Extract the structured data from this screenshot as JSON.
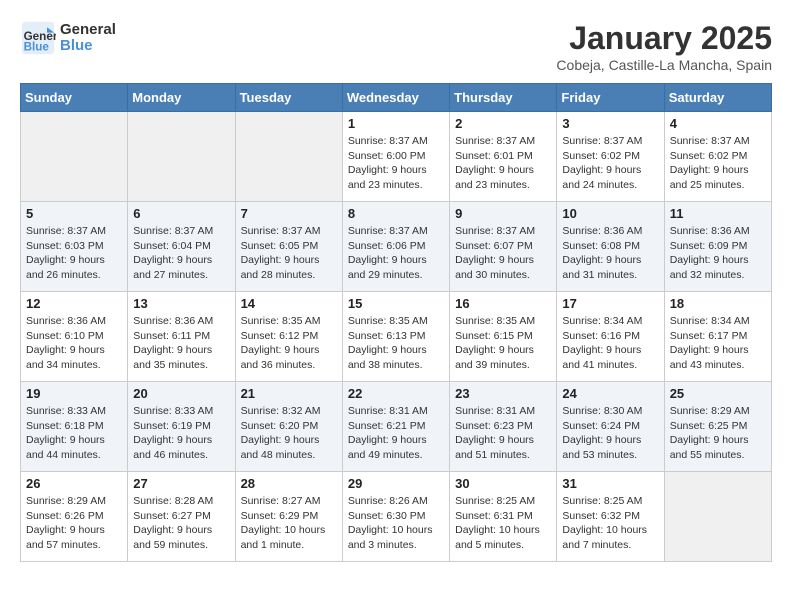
{
  "header": {
    "logo_line1": "General",
    "logo_line2": "Blue",
    "title": "January 2025",
    "subtitle": "Cobeja, Castille-La Mancha, Spain"
  },
  "weekdays": [
    "Sunday",
    "Monday",
    "Tuesday",
    "Wednesday",
    "Thursday",
    "Friday",
    "Saturday"
  ],
  "weeks": [
    [
      {
        "day": "",
        "sunrise": "",
        "sunset": "",
        "daylight": ""
      },
      {
        "day": "",
        "sunrise": "",
        "sunset": "",
        "daylight": ""
      },
      {
        "day": "",
        "sunrise": "",
        "sunset": "",
        "daylight": ""
      },
      {
        "day": "1",
        "sunrise": "Sunrise: 8:37 AM",
        "sunset": "Sunset: 6:00 PM",
        "daylight": "Daylight: 9 hours and 23 minutes."
      },
      {
        "day": "2",
        "sunrise": "Sunrise: 8:37 AM",
        "sunset": "Sunset: 6:01 PM",
        "daylight": "Daylight: 9 hours and 23 minutes."
      },
      {
        "day": "3",
        "sunrise": "Sunrise: 8:37 AM",
        "sunset": "Sunset: 6:02 PM",
        "daylight": "Daylight: 9 hours and 24 minutes."
      },
      {
        "day": "4",
        "sunrise": "Sunrise: 8:37 AM",
        "sunset": "Sunset: 6:02 PM",
        "daylight": "Daylight: 9 hours and 25 minutes."
      }
    ],
    [
      {
        "day": "5",
        "sunrise": "Sunrise: 8:37 AM",
        "sunset": "Sunset: 6:03 PM",
        "daylight": "Daylight: 9 hours and 26 minutes."
      },
      {
        "day": "6",
        "sunrise": "Sunrise: 8:37 AM",
        "sunset": "Sunset: 6:04 PM",
        "daylight": "Daylight: 9 hours and 27 minutes."
      },
      {
        "day": "7",
        "sunrise": "Sunrise: 8:37 AM",
        "sunset": "Sunset: 6:05 PM",
        "daylight": "Daylight: 9 hours and 28 minutes."
      },
      {
        "day": "8",
        "sunrise": "Sunrise: 8:37 AM",
        "sunset": "Sunset: 6:06 PM",
        "daylight": "Daylight: 9 hours and 29 minutes."
      },
      {
        "day": "9",
        "sunrise": "Sunrise: 8:37 AM",
        "sunset": "Sunset: 6:07 PM",
        "daylight": "Daylight: 9 hours and 30 minutes."
      },
      {
        "day": "10",
        "sunrise": "Sunrise: 8:36 AM",
        "sunset": "Sunset: 6:08 PM",
        "daylight": "Daylight: 9 hours and 31 minutes."
      },
      {
        "day": "11",
        "sunrise": "Sunrise: 8:36 AM",
        "sunset": "Sunset: 6:09 PM",
        "daylight": "Daylight: 9 hours and 32 minutes."
      }
    ],
    [
      {
        "day": "12",
        "sunrise": "Sunrise: 8:36 AM",
        "sunset": "Sunset: 6:10 PM",
        "daylight": "Daylight: 9 hours and 34 minutes."
      },
      {
        "day": "13",
        "sunrise": "Sunrise: 8:36 AM",
        "sunset": "Sunset: 6:11 PM",
        "daylight": "Daylight: 9 hours and 35 minutes."
      },
      {
        "day": "14",
        "sunrise": "Sunrise: 8:35 AM",
        "sunset": "Sunset: 6:12 PM",
        "daylight": "Daylight: 9 hours and 36 minutes."
      },
      {
        "day": "15",
        "sunrise": "Sunrise: 8:35 AM",
        "sunset": "Sunset: 6:13 PM",
        "daylight": "Daylight: 9 hours and 38 minutes."
      },
      {
        "day": "16",
        "sunrise": "Sunrise: 8:35 AM",
        "sunset": "Sunset: 6:15 PM",
        "daylight": "Daylight: 9 hours and 39 minutes."
      },
      {
        "day": "17",
        "sunrise": "Sunrise: 8:34 AM",
        "sunset": "Sunset: 6:16 PM",
        "daylight": "Daylight: 9 hours and 41 minutes."
      },
      {
        "day": "18",
        "sunrise": "Sunrise: 8:34 AM",
        "sunset": "Sunset: 6:17 PM",
        "daylight": "Daylight: 9 hours and 43 minutes."
      }
    ],
    [
      {
        "day": "19",
        "sunrise": "Sunrise: 8:33 AM",
        "sunset": "Sunset: 6:18 PM",
        "daylight": "Daylight: 9 hours and 44 minutes."
      },
      {
        "day": "20",
        "sunrise": "Sunrise: 8:33 AM",
        "sunset": "Sunset: 6:19 PM",
        "daylight": "Daylight: 9 hours and 46 minutes."
      },
      {
        "day": "21",
        "sunrise": "Sunrise: 8:32 AM",
        "sunset": "Sunset: 6:20 PM",
        "daylight": "Daylight: 9 hours and 48 minutes."
      },
      {
        "day": "22",
        "sunrise": "Sunrise: 8:31 AM",
        "sunset": "Sunset: 6:21 PM",
        "daylight": "Daylight: 9 hours and 49 minutes."
      },
      {
        "day": "23",
        "sunrise": "Sunrise: 8:31 AM",
        "sunset": "Sunset: 6:23 PM",
        "daylight": "Daylight: 9 hours and 51 minutes."
      },
      {
        "day": "24",
        "sunrise": "Sunrise: 8:30 AM",
        "sunset": "Sunset: 6:24 PM",
        "daylight": "Daylight: 9 hours and 53 minutes."
      },
      {
        "day": "25",
        "sunrise": "Sunrise: 8:29 AM",
        "sunset": "Sunset: 6:25 PM",
        "daylight": "Daylight: 9 hours and 55 minutes."
      }
    ],
    [
      {
        "day": "26",
        "sunrise": "Sunrise: 8:29 AM",
        "sunset": "Sunset: 6:26 PM",
        "daylight": "Daylight: 9 hours and 57 minutes."
      },
      {
        "day": "27",
        "sunrise": "Sunrise: 8:28 AM",
        "sunset": "Sunset: 6:27 PM",
        "daylight": "Daylight: 9 hours and 59 minutes."
      },
      {
        "day": "28",
        "sunrise": "Sunrise: 8:27 AM",
        "sunset": "Sunset: 6:29 PM",
        "daylight": "Daylight: 10 hours and 1 minute."
      },
      {
        "day": "29",
        "sunrise": "Sunrise: 8:26 AM",
        "sunset": "Sunset: 6:30 PM",
        "daylight": "Daylight: 10 hours and 3 minutes."
      },
      {
        "day": "30",
        "sunrise": "Sunrise: 8:25 AM",
        "sunset": "Sunset: 6:31 PM",
        "daylight": "Daylight: 10 hours and 5 minutes."
      },
      {
        "day": "31",
        "sunrise": "Sunrise: 8:25 AM",
        "sunset": "Sunset: 6:32 PM",
        "daylight": "Daylight: 10 hours and 7 minutes."
      },
      {
        "day": "",
        "sunrise": "",
        "sunset": "",
        "daylight": ""
      }
    ]
  ]
}
